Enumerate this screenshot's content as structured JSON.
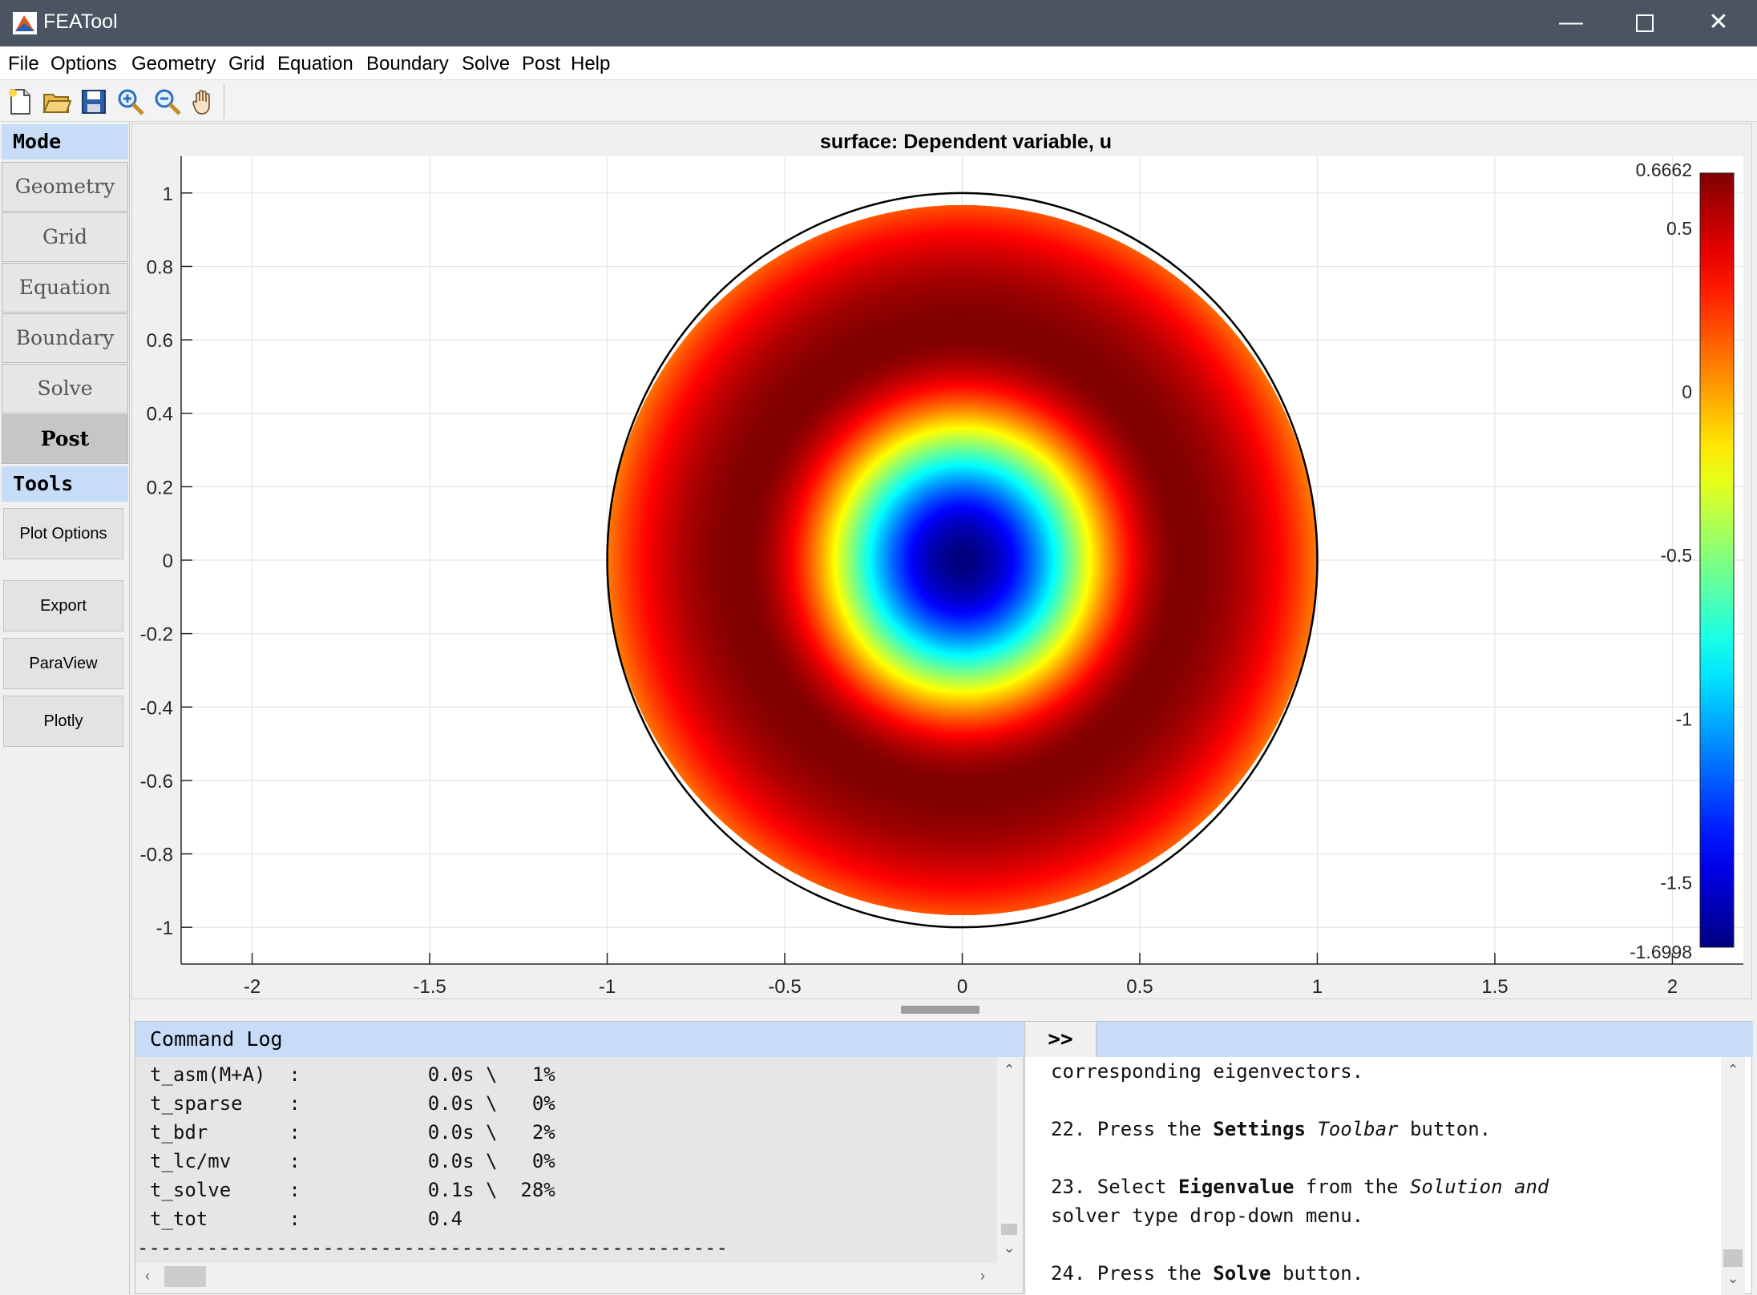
{
  "window": {
    "title": "FEATool",
    "min_icon": "minimize-icon",
    "max_icon": "maximize-icon",
    "close_icon": "close-icon"
  },
  "menu": [
    "File",
    "Options",
    "Geometry",
    "Grid",
    "Equation",
    "Boundary",
    "Solve",
    "Post",
    "Help"
  ],
  "toolbar": [
    "new-file-icon",
    "open-folder-icon",
    "save-icon",
    "zoom-in-icon",
    "zoom-out-icon",
    "pan-hand-icon"
  ],
  "sidebar": {
    "mode_header": "Mode",
    "modes": [
      "Geometry",
      "Grid",
      "Equation",
      "Boundary",
      "Solve",
      "Post"
    ],
    "active_mode": "Post",
    "tools_header": "Tools",
    "tools": [
      "Plot Options",
      "Export",
      "ParaView",
      "Plotly"
    ]
  },
  "chart_data": {
    "type": "heatmap",
    "title": "surface: Dependent variable, u",
    "xlim": [
      -2.2,
      2.2
    ],
    "ylim": [
      -1.1,
      1.1
    ],
    "xticks": [
      -2,
      -1.5,
      -1,
      -0.5,
      0,
      0.5,
      1,
      1.5,
      2
    ],
    "yticks": [
      -1,
      -0.8,
      -0.6,
      -0.4,
      -0.2,
      0,
      0.2,
      0.4,
      0.6,
      0.8,
      1
    ],
    "grid": true,
    "domain": "circle, center (0,0), radius 1",
    "field": "radially symmetric: minimum at center, maximum ring near r = 0.62",
    "min_at_center": -1.6998,
    "colorbar": {
      "colormap": "jet",
      "min": -1.6998,
      "max": 0.6662,
      "min_label": "-1.6998",
      "max_label": "0.6662",
      "ticks": [
        0.5,
        0,
        -0.5,
        -1,
        -1.5
      ],
      "placement": "right"
    }
  },
  "command_log": {
    "header": "Command Log",
    "lines": [
      "t_asm(M+A)  :           0.0s \\   1%",
      "t_sparse    :           0.0s \\   0%",
      "t_bdr       :           0.0s \\   2%",
      "t_lc/mv     :           0.0s \\   0%",
      "t_solve     :           0.1s \\  28%",
      "t_tot       :           0.4",
      "---------------------------------------------------"
    ]
  },
  "tutorial": {
    "expand_label": ">>",
    "lines": [
      [
        {
          "t": "corresponding eigenvectors."
        }
      ],
      [
        {
          "t": "22. Press the "
        },
        {
          "t": "Settings",
          "b": true
        },
        {
          "t": " "
        },
        {
          "t": "Toolbar",
          "i": true
        },
        {
          "t": " button."
        }
      ],
      [
        {
          "t": "23. Select "
        },
        {
          "t": "Eigenvalue",
          "b": true
        },
        {
          "t": " from the "
        },
        {
          "t": "Solution and",
          "i": true
        }
      ],
      [
        {
          "t": "solver type drop-down menu."
        }
      ],
      [
        {
          "t": "24. Press the "
        },
        {
          "t": "Solve",
          "b": true
        },
        {
          "t": " button."
        }
      ]
    ]
  }
}
